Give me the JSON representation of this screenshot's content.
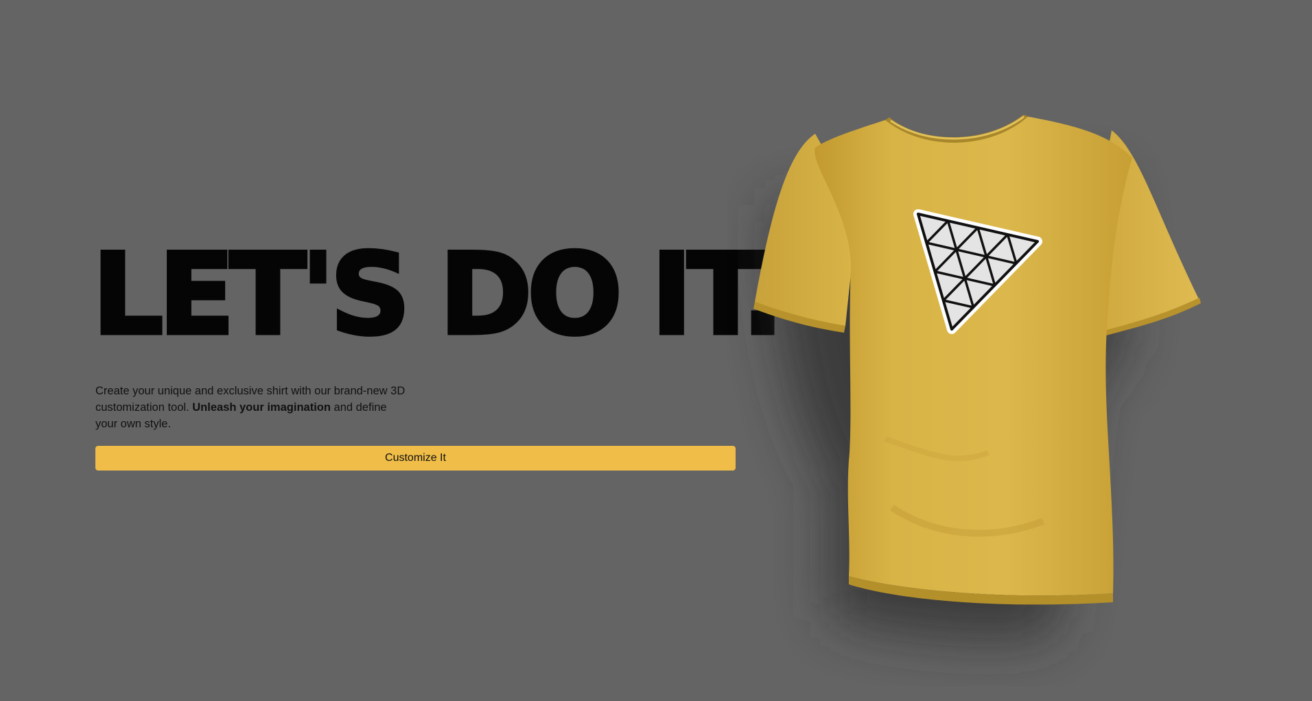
{
  "hero": {
    "headline": "LET'S DO IT.",
    "description": {
      "before": "Create your unique and exclusive shirt with our brand-new 3D customization tool. ",
      "emphasis": "Unleash your imagination",
      "after": " and define your own style."
    },
    "cta_label": "Customize It"
  },
  "shirt": {
    "color": "#d4ad3e",
    "logo": "triangle-grid-logo"
  },
  "colors": {
    "background": "#646464",
    "accent": "#efbd48",
    "text": "#050505"
  }
}
